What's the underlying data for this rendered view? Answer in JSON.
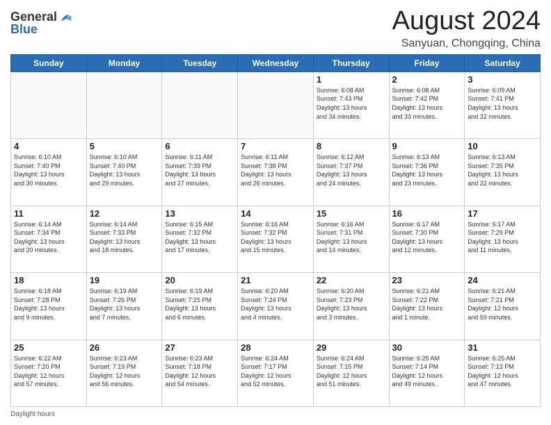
{
  "logo": {
    "line1": "General",
    "line2": "Blue"
  },
  "title": "August 2024",
  "subtitle": "Sanyuan, Chongqing, China",
  "days_of_week": [
    "Sunday",
    "Monday",
    "Tuesday",
    "Wednesday",
    "Thursday",
    "Friday",
    "Saturday"
  ],
  "weeks": [
    [
      {
        "day": "",
        "info": ""
      },
      {
        "day": "",
        "info": ""
      },
      {
        "day": "",
        "info": ""
      },
      {
        "day": "",
        "info": ""
      },
      {
        "day": "1",
        "info": "Sunrise: 6:08 AM\nSunset: 7:43 PM\nDaylight: 13 hours\nand 34 minutes."
      },
      {
        "day": "2",
        "info": "Sunrise: 6:08 AM\nSunset: 7:42 PM\nDaylight: 13 hours\nand 33 minutes."
      },
      {
        "day": "3",
        "info": "Sunrise: 6:09 AM\nSunset: 7:41 PM\nDaylight: 13 hours\nand 32 minutes."
      }
    ],
    [
      {
        "day": "4",
        "info": "Sunrise: 6:10 AM\nSunset: 7:40 PM\nDaylight: 13 hours\nand 30 minutes."
      },
      {
        "day": "5",
        "info": "Sunrise: 6:10 AM\nSunset: 7:40 PM\nDaylight: 13 hours\nand 29 minutes."
      },
      {
        "day": "6",
        "info": "Sunrise: 6:11 AM\nSunset: 7:39 PM\nDaylight: 13 hours\nand 27 minutes."
      },
      {
        "day": "7",
        "info": "Sunrise: 6:11 AM\nSunset: 7:38 PM\nDaylight: 13 hours\nand 26 minutes."
      },
      {
        "day": "8",
        "info": "Sunrise: 6:12 AM\nSunset: 7:37 PM\nDaylight: 13 hours\nand 24 minutes."
      },
      {
        "day": "9",
        "info": "Sunrise: 6:13 AM\nSunset: 7:36 PM\nDaylight: 13 hours\nand 23 minutes."
      },
      {
        "day": "10",
        "info": "Sunrise: 6:13 AM\nSunset: 7:35 PM\nDaylight: 13 hours\nand 22 minutes."
      }
    ],
    [
      {
        "day": "11",
        "info": "Sunrise: 6:14 AM\nSunset: 7:34 PM\nDaylight: 13 hours\nand 20 minutes."
      },
      {
        "day": "12",
        "info": "Sunrise: 6:14 AM\nSunset: 7:33 PM\nDaylight: 13 hours\nand 18 minutes."
      },
      {
        "day": "13",
        "info": "Sunrise: 6:15 AM\nSunset: 7:32 PM\nDaylight: 13 hours\nand 17 minutes."
      },
      {
        "day": "14",
        "info": "Sunrise: 6:16 AM\nSunset: 7:32 PM\nDaylight: 13 hours\nand 15 minutes."
      },
      {
        "day": "15",
        "info": "Sunrise: 6:16 AM\nSunset: 7:31 PM\nDaylight: 13 hours\nand 14 minutes."
      },
      {
        "day": "16",
        "info": "Sunrise: 6:17 AM\nSunset: 7:30 PM\nDaylight: 13 hours\nand 12 minutes."
      },
      {
        "day": "17",
        "info": "Sunrise: 6:17 AM\nSunset: 7:29 PM\nDaylight: 13 hours\nand 11 minutes."
      }
    ],
    [
      {
        "day": "18",
        "info": "Sunrise: 6:18 AM\nSunset: 7:28 PM\nDaylight: 13 hours\nand 9 minutes."
      },
      {
        "day": "19",
        "info": "Sunrise: 6:19 AM\nSunset: 7:26 PM\nDaylight: 13 hours\nand 7 minutes."
      },
      {
        "day": "20",
        "info": "Sunrise: 6:19 AM\nSunset: 7:25 PM\nDaylight: 13 hours\nand 6 minutes."
      },
      {
        "day": "21",
        "info": "Sunrise: 6:20 AM\nSunset: 7:24 PM\nDaylight: 13 hours\nand 4 minutes."
      },
      {
        "day": "22",
        "info": "Sunrise: 6:20 AM\nSunset: 7:23 PM\nDaylight: 13 hours\nand 3 minutes."
      },
      {
        "day": "23",
        "info": "Sunrise: 6:21 AM\nSunset: 7:22 PM\nDaylight: 13 hours\nand 1 minute."
      },
      {
        "day": "24",
        "info": "Sunrise: 6:21 AM\nSunset: 7:21 PM\nDaylight: 12 hours\nand 59 minutes."
      }
    ],
    [
      {
        "day": "25",
        "info": "Sunrise: 6:22 AM\nSunset: 7:20 PM\nDaylight: 12 hours\nand 57 minutes."
      },
      {
        "day": "26",
        "info": "Sunrise: 6:23 AM\nSunset: 7:19 PM\nDaylight: 12 hours\nand 56 minutes."
      },
      {
        "day": "27",
        "info": "Sunrise: 6:23 AM\nSunset: 7:18 PM\nDaylight: 12 hours\nand 54 minutes."
      },
      {
        "day": "28",
        "info": "Sunrise: 6:24 AM\nSunset: 7:17 PM\nDaylight: 12 hours\nand 52 minutes."
      },
      {
        "day": "29",
        "info": "Sunrise: 6:24 AM\nSunset: 7:15 PM\nDaylight: 12 hours\nand 51 minutes."
      },
      {
        "day": "30",
        "info": "Sunrise: 6:25 AM\nSunset: 7:14 PM\nDaylight: 12 hours\nand 49 minutes."
      },
      {
        "day": "31",
        "info": "Sunrise: 6:25 AM\nSunset: 7:13 PM\nDaylight: 12 hours\nand 47 minutes."
      }
    ]
  ],
  "footer": "Daylight hours"
}
